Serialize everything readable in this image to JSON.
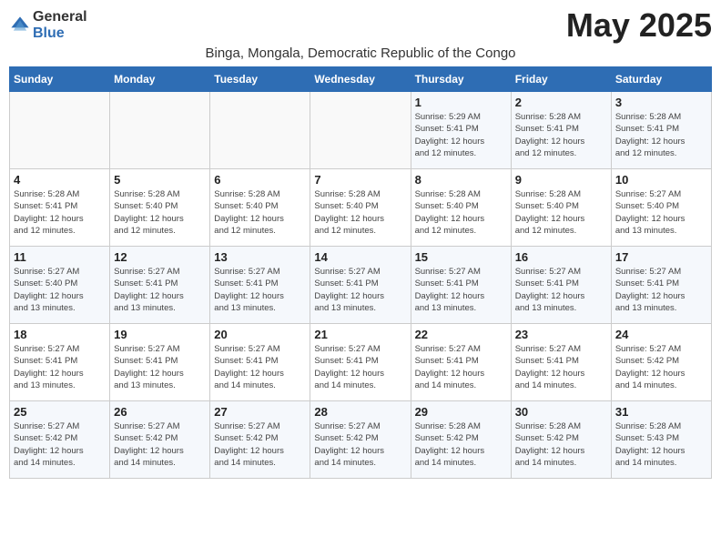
{
  "header": {
    "logo_general": "General",
    "logo_blue": "Blue",
    "month_title": "May 2025",
    "subtitle": "Binga, Mongala, Democratic Republic of the Congo"
  },
  "weekdays": [
    "Sunday",
    "Monday",
    "Tuesday",
    "Wednesday",
    "Thursday",
    "Friday",
    "Saturday"
  ],
  "weeks": [
    [
      {
        "day": "",
        "info": ""
      },
      {
        "day": "",
        "info": ""
      },
      {
        "day": "",
        "info": ""
      },
      {
        "day": "",
        "info": ""
      },
      {
        "day": "1",
        "info": "Sunrise: 5:29 AM\nSunset: 5:41 PM\nDaylight: 12 hours\nand 12 minutes."
      },
      {
        "day": "2",
        "info": "Sunrise: 5:28 AM\nSunset: 5:41 PM\nDaylight: 12 hours\nand 12 minutes."
      },
      {
        "day": "3",
        "info": "Sunrise: 5:28 AM\nSunset: 5:41 PM\nDaylight: 12 hours\nand 12 minutes."
      }
    ],
    [
      {
        "day": "4",
        "info": "Sunrise: 5:28 AM\nSunset: 5:41 PM\nDaylight: 12 hours\nand 12 minutes."
      },
      {
        "day": "5",
        "info": "Sunrise: 5:28 AM\nSunset: 5:40 PM\nDaylight: 12 hours\nand 12 minutes."
      },
      {
        "day": "6",
        "info": "Sunrise: 5:28 AM\nSunset: 5:40 PM\nDaylight: 12 hours\nand 12 minutes."
      },
      {
        "day": "7",
        "info": "Sunrise: 5:28 AM\nSunset: 5:40 PM\nDaylight: 12 hours\nand 12 minutes."
      },
      {
        "day": "8",
        "info": "Sunrise: 5:28 AM\nSunset: 5:40 PM\nDaylight: 12 hours\nand 12 minutes."
      },
      {
        "day": "9",
        "info": "Sunrise: 5:28 AM\nSunset: 5:40 PM\nDaylight: 12 hours\nand 12 minutes."
      },
      {
        "day": "10",
        "info": "Sunrise: 5:27 AM\nSunset: 5:40 PM\nDaylight: 12 hours\nand 13 minutes."
      }
    ],
    [
      {
        "day": "11",
        "info": "Sunrise: 5:27 AM\nSunset: 5:40 PM\nDaylight: 12 hours\nand 13 minutes."
      },
      {
        "day": "12",
        "info": "Sunrise: 5:27 AM\nSunset: 5:41 PM\nDaylight: 12 hours\nand 13 minutes."
      },
      {
        "day": "13",
        "info": "Sunrise: 5:27 AM\nSunset: 5:41 PM\nDaylight: 12 hours\nand 13 minutes."
      },
      {
        "day": "14",
        "info": "Sunrise: 5:27 AM\nSunset: 5:41 PM\nDaylight: 12 hours\nand 13 minutes."
      },
      {
        "day": "15",
        "info": "Sunrise: 5:27 AM\nSunset: 5:41 PM\nDaylight: 12 hours\nand 13 minutes."
      },
      {
        "day": "16",
        "info": "Sunrise: 5:27 AM\nSunset: 5:41 PM\nDaylight: 12 hours\nand 13 minutes."
      },
      {
        "day": "17",
        "info": "Sunrise: 5:27 AM\nSunset: 5:41 PM\nDaylight: 12 hours\nand 13 minutes."
      }
    ],
    [
      {
        "day": "18",
        "info": "Sunrise: 5:27 AM\nSunset: 5:41 PM\nDaylight: 12 hours\nand 13 minutes."
      },
      {
        "day": "19",
        "info": "Sunrise: 5:27 AM\nSunset: 5:41 PM\nDaylight: 12 hours\nand 13 minutes."
      },
      {
        "day": "20",
        "info": "Sunrise: 5:27 AM\nSunset: 5:41 PM\nDaylight: 12 hours\nand 14 minutes."
      },
      {
        "day": "21",
        "info": "Sunrise: 5:27 AM\nSunset: 5:41 PM\nDaylight: 12 hours\nand 14 minutes."
      },
      {
        "day": "22",
        "info": "Sunrise: 5:27 AM\nSunset: 5:41 PM\nDaylight: 12 hours\nand 14 minutes."
      },
      {
        "day": "23",
        "info": "Sunrise: 5:27 AM\nSunset: 5:41 PM\nDaylight: 12 hours\nand 14 minutes."
      },
      {
        "day": "24",
        "info": "Sunrise: 5:27 AM\nSunset: 5:42 PM\nDaylight: 12 hours\nand 14 minutes."
      }
    ],
    [
      {
        "day": "25",
        "info": "Sunrise: 5:27 AM\nSunset: 5:42 PM\nDaylight: 12 hours\nand 14 minutes."
      },
      {
        "day": "26",
        "info": "Sunrise: 5:27 AM\nSunset: 5:42 PM\nDaylight: 12 hours\nand 14 minutes."
      },
      {
        "day": "27",
        "info": "Sunrise: 5:27 AM\nSunset: 5:42 PM\nDaylight: 12 hours\nand 14 minutes."
      },
      {
        "day": "28",
        "info": "Sunrise: 5:27 AM\nSunset: 5:42 PM\nDaylight: 12 hours\nand 14 minutes."
      },
      {
        "day": "29",
        "info": "Sunrise: 5:28 AM\nSunset: 5:42 PM\nDaylight: 12 hours\nand 14 minutes."
      },
      {
        "day": "30",
        "info": "Sunrise: 5:28 AM\nSunset: 5:42 PM\nDaylight: 12 hours\nand 14 minutes."
      },
      {
        "day": "31",
        "info": "Sunrise: 5:28 AM\nSunset: 5:43 PM\nDaylight: 12 hours\nand 14 minutes."
      }
    ]
  ]
}
